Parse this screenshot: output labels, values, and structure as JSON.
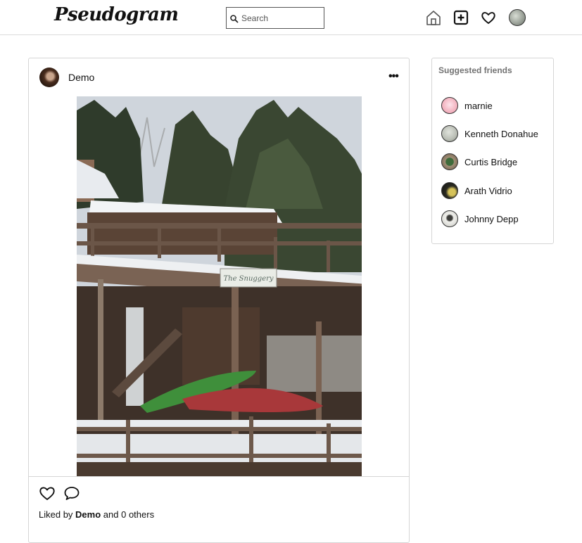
{
  "app": {
    "logo": "Pseudogram"
  },
  "search": {
    "placeholder": "Search",
    "value": ""
  },
  "nav": {
    "icons": [
      "home-icon",
      "add-post-icon",
      "heart-icon",
      "profile-avatar"
    ]
  },
  "post": {
    "username": "Demo",
    "more_label": "•••",
    "sign_text": "The Snuggery",
    "likes_prefix": "Liked by",
    "liked_by": "Demo",
    "likes_suffix": "and 0 others"
  },
  "suggestions": {
    "title": "Suggested friends",
    "friends": [
      {
        "name": "marnie",
        "avatar_color": "#f4b8c4"
      },
      {
        "name": "Kenneth Donahue",
        "avatar_color": "#b9bdb4"
      },
      {
        "name": "Curtis Bridge",
        "avatar_color": "#5b6e4a"
      },
      {
        "name": "Arath Vidrio",
        "avatar_color": "#2b2b22"
      },
      {
        "name": "Johnny Depp",
        "avatar_color": "#d7d7d2"
      }
    ]
  }
}
